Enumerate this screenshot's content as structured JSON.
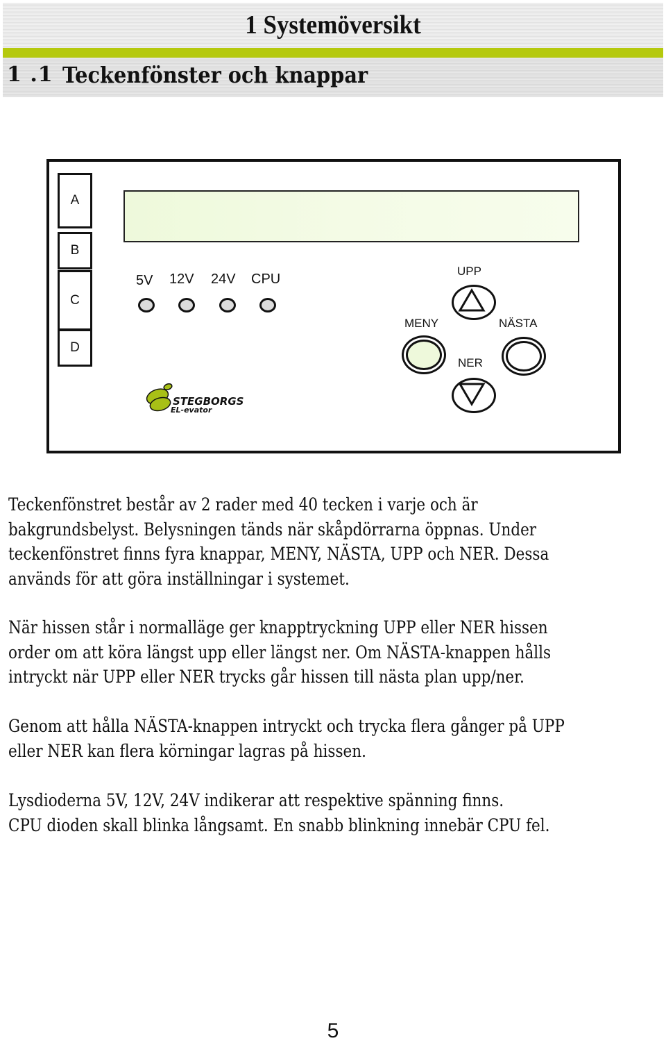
{
  "header": {
    "chapter_title": "1 Systemöversikt",
    "section_number": "1 .1",
    "section_title": "Teckenfönster och knappar",
    "accent_color": "#b5c90d"
  },
  "panel": {
    "side_buttons": [
      "A",
      "B",
      "C",
      "D"
    ],
    "display": {
      "rows": 2,
      "chars_per_row": 40,
      "color": "#f2fbe2"
    },
    "leds": [
      {
        "label": "5V"
      },
      {
        "label": "12V"
      },
      {
        "label": "24V"
      },
      {
        "label": "CPU"
      }
    ],
    "buttons": {
      "up": {
        "label": "UPP",
        "icon": "triangle-up-icon"
      },
      "menu": {
        "label": "MENY",
        "fill": "#eef9db"
      },
      "next": {
        "label": "NÄSTA"
      },
      "down": {
        "label": "NER",
        "icon": "triangle-down-icon"
      }
    },
    "logo": {
      "name": "STEGBORGS",
      "tagline": "EL-evator",
      "color": "#a8c016"
    }
  },
  "body": {
    "paragraphs": [
      [
        "Teckenfönstret består av 2 rader med 40 tecken i varje och är",
        "bakgrundsbelyst. Belysningen tänds när skåpdörrarna öppnas. Under",
        "teckenfönstret finns fyra knappar, MENY, NÄSTA, UPP och NER. Dessa",
        "används för att göra inställningar i systemet."
      ],
      [
        "När hissen står i normalläge ger knapptryckning UPP eller NER hissen",
        "order om att köra längst upp eller längst ner. Om NÄSTA-knappen hålls",
        "intryckt när UPP eller NER trycks går hissen till nästa plan upp/ner."
      ],
      [
        "Genom att hålla NÄSTA-knappen intryckt och trycka flera gånger på UPP",
        "eller NER kan flera körningar lagras på hissen."
      ],
      [
        "Lysdioderna 5V, 12V, 24V indikerar att respektive spänning finns.",
        "CPU dioden skall blinka långsamt. En snabb blinkning innebär CPU fel."
      ]
    ]
  },
  "footer": {
    "page_number": "5"
  }
}
